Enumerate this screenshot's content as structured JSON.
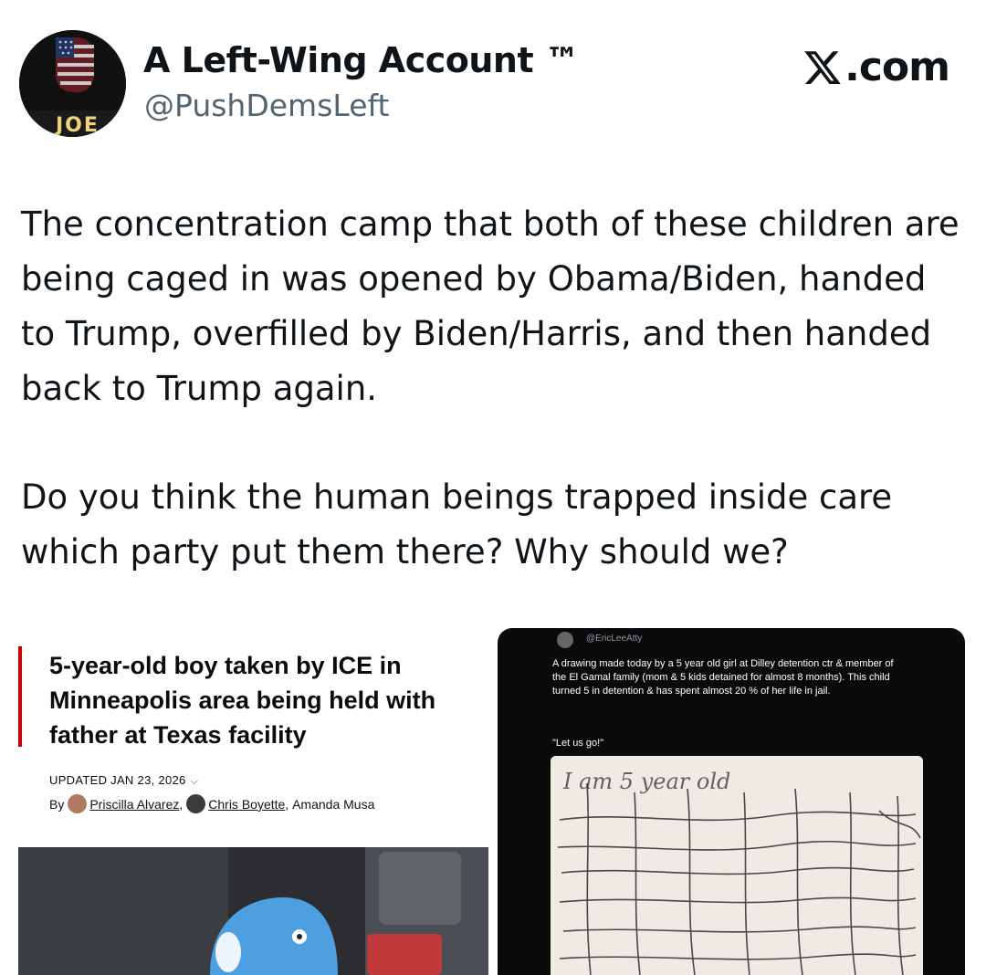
{
  "header": {
    "display_name": "A Left-Wing Account ™",
    "handle": "@PushDemsLeft",
    "brand": ".com",
    "avatar_text": "JOE"
  },
  "tweet": {
    "paragraph_1": "The concentration camp that both of these children are being caged in was opened by Obama/Biden, handed to Trump, overfilled by Biden/Harris, and then handed back to Trump again.",
    "paragraph_2": "Do you think the human beings trapped inside care which party put them there? Why should we?"
  },
  "news_card": {
    "headline": "5-year-old boy taken by ICE in Minneapolis area being held with father at Texas facility",
    "updated": "UPDATED JAN 23, 2026",
    "by_label": "By",
    "author_1": "Priscilla Alvarez",
    "author_2": "Chris Boyette",
    "author_3": "Amanda Musa",
    "sep": ",",
    "accent_color": "#cc0000"
  },
  "embedded_post": {
    "handle": "@EricLeeAtty",
    "text": "A drawing made today by a 5 year old girl at Dilley detention ctr & member of the El Gamal family (mom & 5 kids detained for almost 8 months). This child turned 5 in detention & has spent almost 20 % of her life in jail.",
    "quote": "\"Let us go!\"",
    "drawing_text": "I am 5 year old"
  }
}
